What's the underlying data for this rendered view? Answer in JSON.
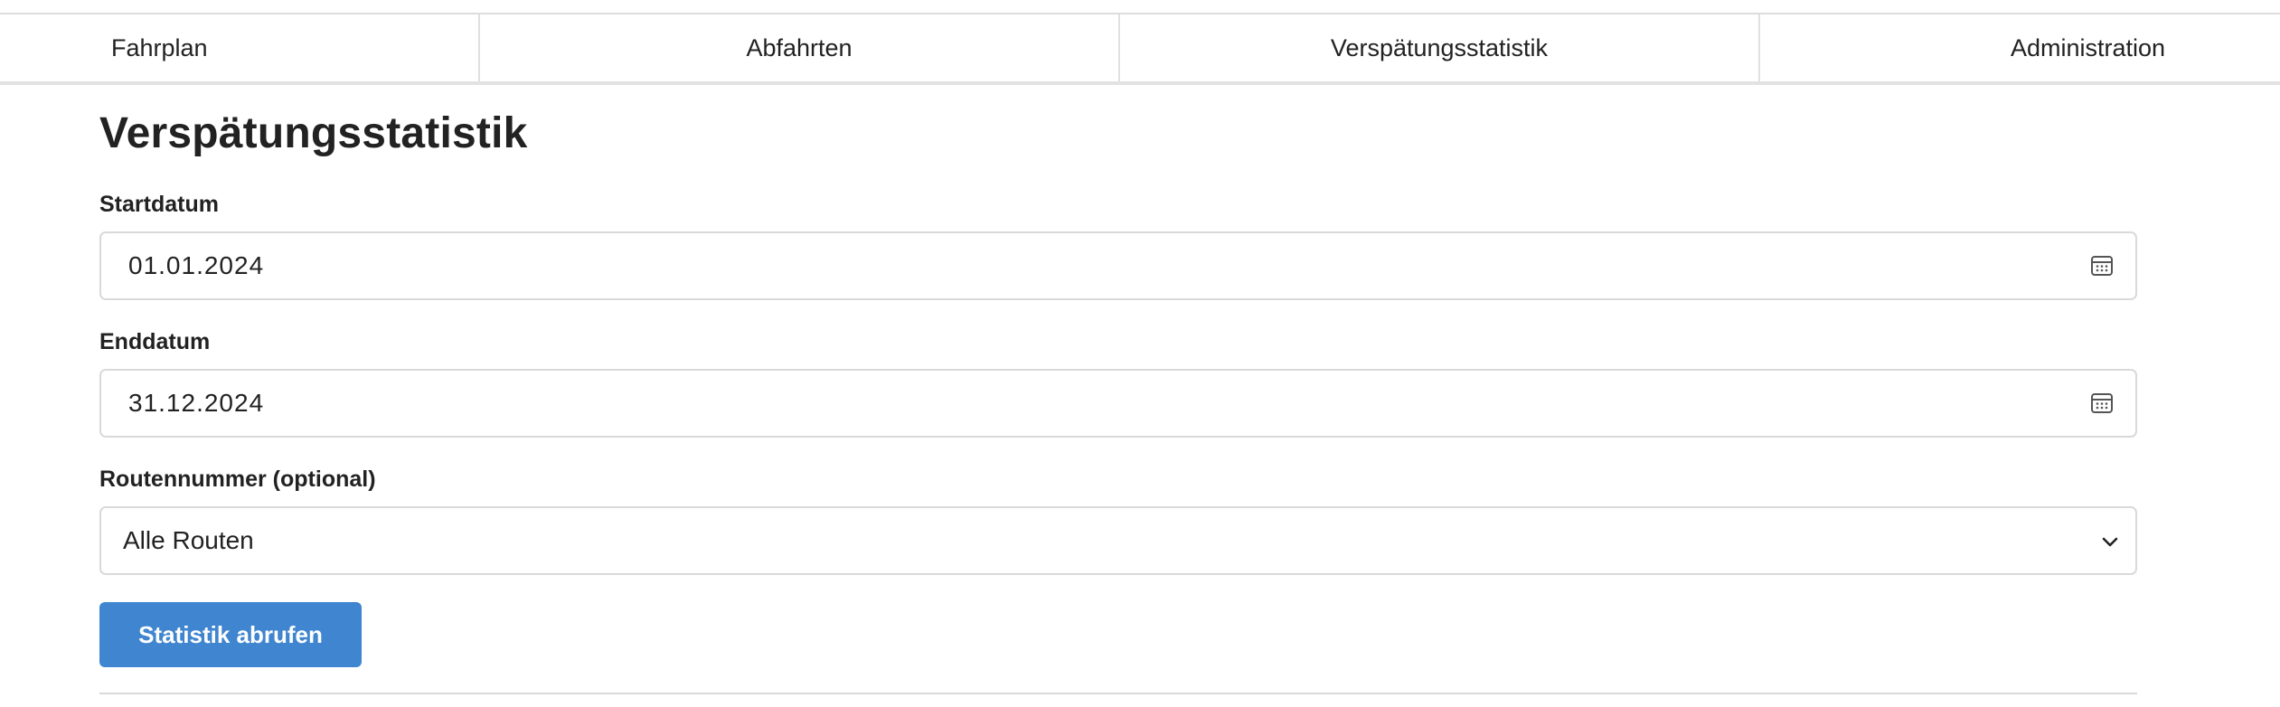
{
  "nav": {
    "tabs": [
      {
        "label": "Fahrplan"
      },
      {
        "label": "Abfahrten"
      },
      {
        "label": "Verspätungsstatistik"
      },
      {
        "label": "Administration"
      }
    ]
  },
  "page": {
    "title": "Verspätungsstatistik"
  },
  "form": {
    "start_date": {
      "label": "Startdatum",
      "value": "01.01.2024",
      "icon": "calendar-icon"
    },
    "end_date": {
      "label": "Enddatum",
      "value": "31.12.2024",
      "icon": "calendar-icon"
    },
    "route": {
      "label": "Routennummer (optional)",
      "selected": "Alle Routen",
      "icon": "chevron-down-icon"
    },
    "submit_label": "Statistik abrufen"
  },
  "colors": {
    "primary_button": "#3f85cf",
    "border": "#d9d9d9",
    "text": "#222222"
  }
}
